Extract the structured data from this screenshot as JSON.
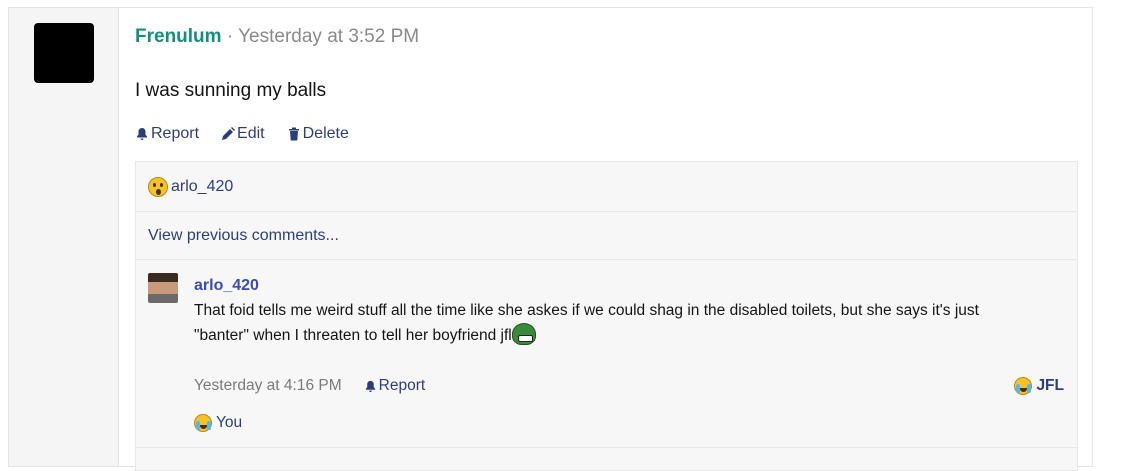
{
  "post": {
    "username": "Frenulum",
    "separator": "·",
    "timestamp": "Yesterday at 3:52 PM",
    "body": "I was sunning my balls",
    "actions": {
      "report": "Report",
      "edit": "Edit",
      "delete": "Delete"
    }
  },
  "reactions": {
    "reactor": "arlo_420",
    "reaction_icon": "wow-emoji"
  },
  "view_previous": "View previous comments...",
  "comment": {
    "username": "arlo_420",
    "text_line1": "That foid tells me weird stuff all the time like she askes if we could shag in the disabled toilets, but she says it's just",
    "text_line2": "\"banter\" when I threaten to tell her boyfriend jfl",
    "inline_emoji": "pepe-emoji",
    "timestamp": "Yesterday at 4:16 PM",
    "report": "Report",
    "reaction_label": "JFL",
    "reaction_icon": "crying-laughing-emoji",
    "reacted_by": "You"
  },
  "colors": {
    "username_accent": "#13907c",
    "link_blue": "#2b3e7a",
    "comment_user": "#3a4bb5"
  }
}
